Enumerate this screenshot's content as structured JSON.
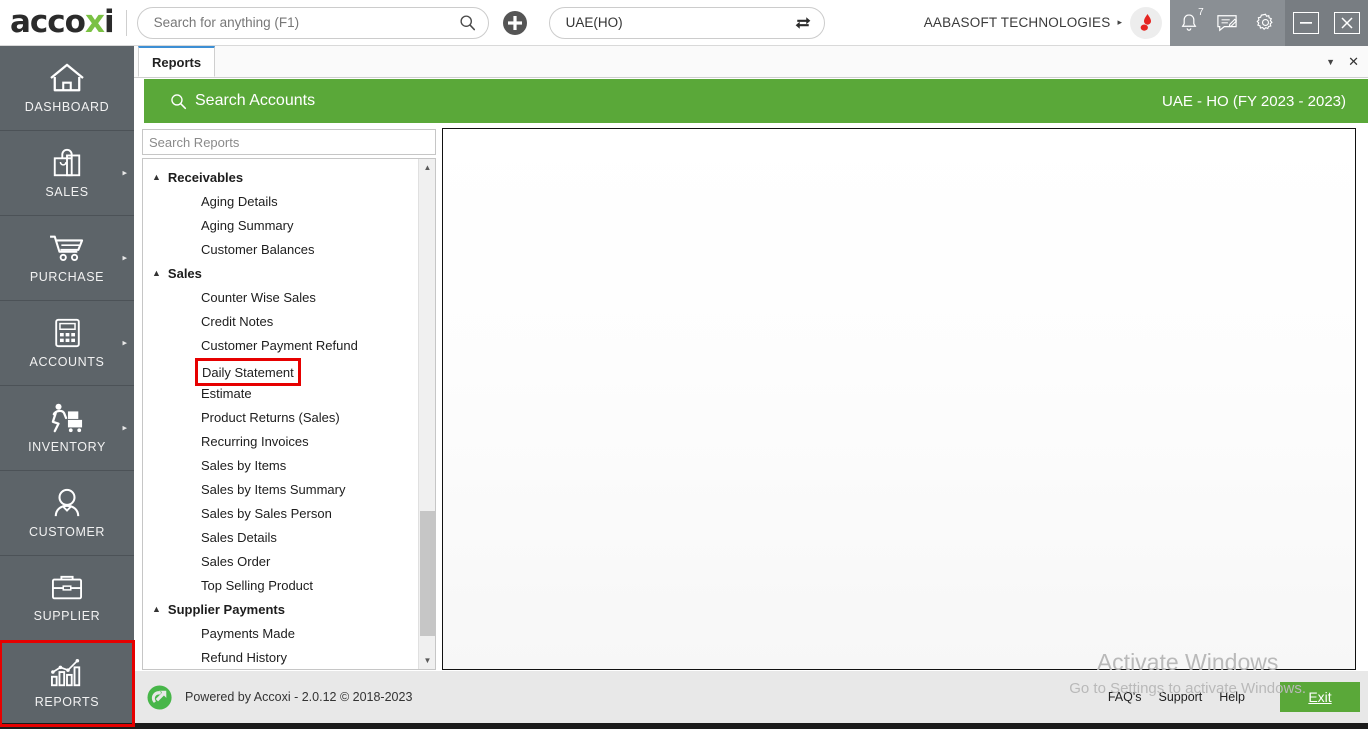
{
  "app": {
    "logo_text_a": "acco",
    "logo_text_x": "x",
    "logo_text_i": "i"
  },
  "header": {
    "search_placeholder": "Search for anything (F1)",
    "search_value": "",
    "search_icon": "search-icon",
    "add_icon": "plus-icon",
    "branch_value": "UAE(HO)",
    "branch_icon": "switch-branch-icon",
    "org_name": "AABASOFT TECHNOLOGIES",
    "org_caret": "▸",
    "avatar_icon": "user-avatar-icon",
    "notification_icon": "bell-icon",
    "notification_count": "7",
    "message_icon": "message-icon",
    "settings_icon": "gear-icon",
    "minimize_label": "–",
    "close_label": "✕"
  },
  "sidebar": {
    "items": [
      {
        "label": "DASHBOARD",
        "icon": "home-icon",
        "has_arrow": false,
        "selected": false
      },
      {
        "label": "SALES",
        "icon": "shopping-bag-icon",
        "has_arrow": true,
        "selected": false
      },
      {
        "label": "PURCHASE",
        "icon": "shopping-cart-icon",
        "has_arrow": true,
        "selected": false
      },
      {
        "label": "ACCOUNTS",
        "icon": "calculator-icon",
        "has_arrow": true,
        "selected": false
      },
      {
        "label": "INVENTORY",
        "icon": "warehouse-worker-icon",
        "has_arrow": true,
        "selected": false
      },
      {
        "label": "CUSTOMER",
        "icon": "person-icon",
        "has_arrow": false,
        "selected": false
      },
      {
        "label": "SUPPLIER",
        "icon": "briefcase-icon",
        "has_arrow": false,
        "selected": false
      },
      {
        "label": "REPORTS",
        "icon": "bar-chart-icon",
        "has_arrow": false,
        "selected": true
      }
    ]
  },
  "tabstrip": {
    "tabs": [
      {
        "label": "Reports",
        "active": true
      }
    ],
    "caret_icon": "chevron-down-icon",
    "close_icon": "close-icon"
  },
  "green_bar": {
    "search_icon": "search-icon",
    "title": "Search Accounts",
    "fiscal_info": "UAE - HO (FY 2023 - 2023)"
  },
  "reports_panel": {
    "search_placeholder": "Search Reports",
    "search_value": "",
    "collapse_icon": "chevron-up-icon",
    "scroll_up_icon": "scroll-up-arrow-icon",
    "scroll_down_icon": "scroll-down-arrow-icon",
    "tree": [
      {
        "group": "Receivables",
        "items": [
          {
            "label": "Aging Details",
            "highlighted": false
          },
          {
            "label": "Aging Summary",
            "highlighted": false
          },
          {
            "label": "Customer Balances",
            "highlighted": false
          }
        ]
      },
      {
        "group": "Sales",
        "items": [
          {
            "label": "Counter Wise Sales",
            "highlighted": false
          },
          {
            "label": "Credit Notes",
            "highlighted": false
          },
          {
            "label": "Customer Payment Refund",
            "highlighted": false
          },
          {
            "label": "Daily Statement",
            "highlighted": true
          },
          {
            "label": "Estimate",
            "highlighted": false
          },
          {
            "label": "Product Returns (Sales)",
            "highlighted": false
          },
          {
            "label": "Recurring Invoices",
            "highlighted": false
          },
          {
            "label": "Sales by Items",
            "highlighted": false
          },
          {
            "label": "Sales by Items Summary",
            "highlighted": false
          },
          {
            "label": "Sales by Sales Person",
            "highlighted": false
          },
          {
            "label": "Sales Details",
            "highlighted": false
          },
          {
            "label": "Sales Order",
            "highlighted": false
          },
          {
            "label": "Top Selling Product",
            "highlighted": false
          }
        ]
      },
      {
        "group": "Supplier Payments",
        "items": [
          {
            "label": "Payments Made",
            "highlighted": false
          },
          {
            "label": "Refund History",
            "highlighted": false
          }
        ]
      }
    ]
  },
  "watermark": {
    "title": "Activate Windows",
    "subtitle": "Go to Settings to activate Windows."
  },
  "footer": {
    "logo_icon": "accoxi-mark-icon",
    "powered_by": "Powered by Accoxi - 2.0.12 © 2018-2023",
    "links": [
      "FAQ's",
      "Support",
      "Help"
    ],
    "exit_label": "Exit"
  },
  "colors": {
    "brand_green": "#5aa839",
    "sidebar_gray": "#5d6469",
    "highlight_red": "#e60000",
    "tab_accent_blue": "#3d8fd4",
    "logo_accent_green": "#7ac143"
  }
}
